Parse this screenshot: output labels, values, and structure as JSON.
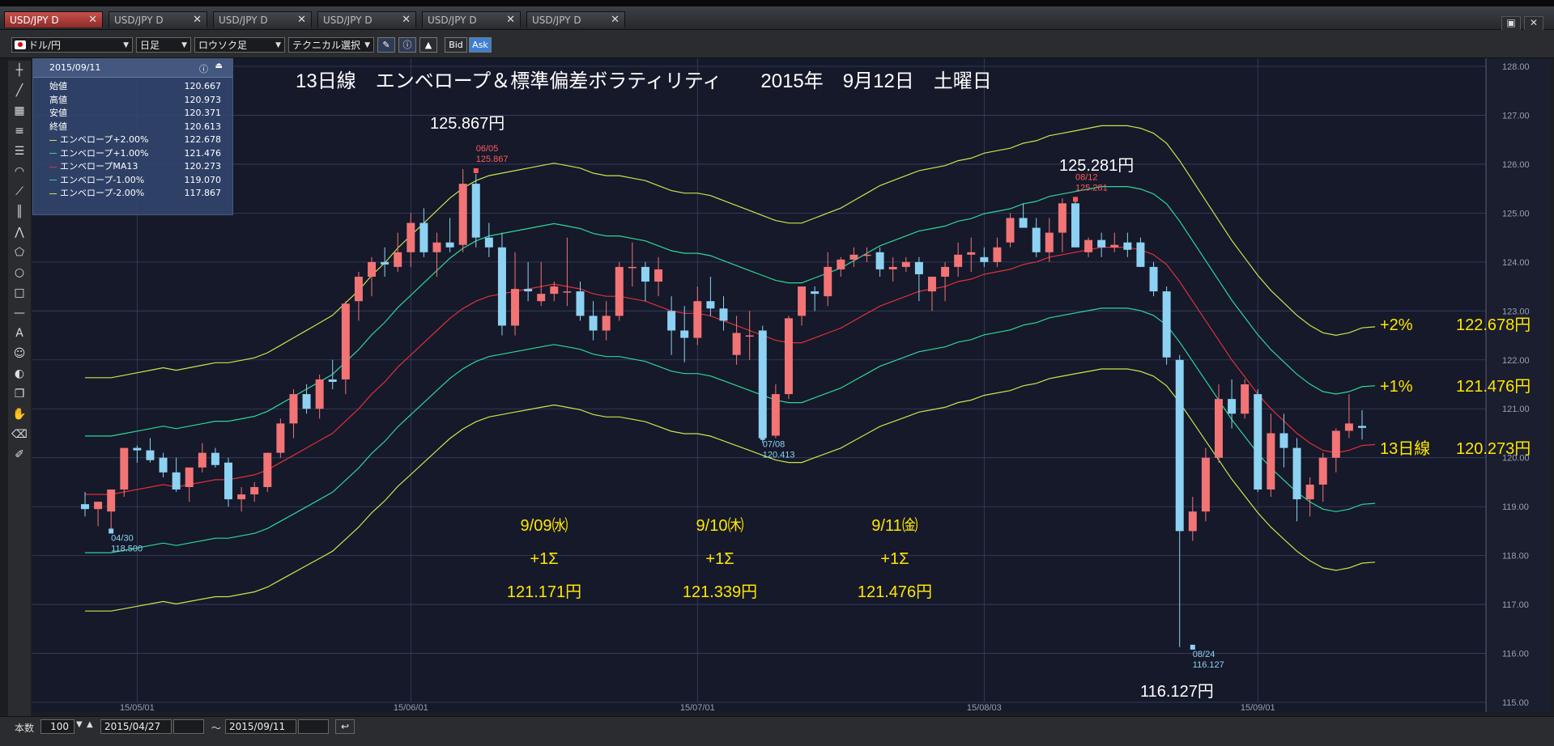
{
  "tabs": [
    {
      "label": "USD/JPY D",
      "active": true
    },
    {
      "label": "USD/JPY D",
      "active": false
    },
    {
      "label": "USD/JPY D",
      "active": false
    },
    {
      "label": "USD/JPY D",
      "active": false
    },
    {
      "label": "USD/JPY D",
      "active": false
    },
    {
      "label": "USD/JPY D",
      "active": false
    }
  ],
  "tab_close": "✕",
  "toolbar": {
    "pair": "ドル/円",
    "timeframe": "日足",
    "chart_type": "ロウソク足",
    "technical": "テクニカル選択",
    "bid": "Bid",
    "ask": "Ask"
  },
  "info_panel": {
    "date": "2015/09/11",
    "rows": [
      {
        "label": "始値",
        "value": "120.667",
        "color": ""
      },
      {
        "label": "高値",
        "value": "120.973",
        "color": ""
      },
      {
        "label": "安値",
        "value": "120.371",
        "color": ""
      },
      {
        "label": "終値",
        "value": "120.613",
        "color": ""
      },
      {
        "label": "エンベロープ+2.00%",
        "value": "122.678",
        "color": "#c8e64a"
      },
      {
        "label": "エンベロープ+1.00%",
        "value": "121.476",
        "color": "#2fd69a"
      },
      {
        "label": "エンベロープMA13",
        "value": "120.273",
        "color": "#e0303a"
      },
      {
        "label": "エンベロープ-1.00%",
        "value": "119.070",
        "color": "#2fd69a"
      },
      {
        "label": "エンベロープ-2.00%",
        "value": "117.867",
        "color": "#c8e64a"
      }
    ]
  },
  "bottom": {
    "count_label": "本数",
    "count_value": "100",
    "from_date": "2015/04/27",
    "tilde": "〜",
    "to_date": "2015/09/11"
  },
  "colors": {
    "background": "#15192a",
    "grid": "#3a4160",
    "up": "#f27475",
    "down": "#8dd2f2",
    "ma": "#e0303a",
    "env1": "#2fd69a",
    "env2": "#c8e64a",
    "annotation": "#ffe600"
  },
  "chart_data": {
    "type": "candlestick",
    "title": "13日線　エンベロープ＆標準偏差ボラティリティ　　2015年　9月12日　土曜日",
    "y_ticks": [
      "128.00",
      "127.00",
      "126.00",
      "125.00",
      "124.00",
      "123.00",
      "122.00",
      "121.00",
      "120.00",
      "119.00",
      "118.00",
      "117.00",
      "116.00",
      "115.00"
    ],
    "ylim": [
      115,
      128
    ],
    "x_ticks": [
      {
        "label": "15/05/01",
        "day": 4
      },
      {
        "label": "15/06/01",
        "day": 25
      },
      {
        "label": "15/07/01",
        "day": 47
      },
      {
        "label": "15/08/03",
        "day": 69
      },
      {
        "label": "15/09/01",
        "day": 90
      }
    ],
    "ohlc": [
      [
        119.05,
        119.3,
        118.8,
        118.95
      ],
      [
        118.95,
        119.1,
        118.6,
        119.1
      ],
      [
        118.9,
        119.3,
        118.5,
        119.35
      ],
      [
        119.35,
        120.2,
        119.2,
        120.2
      ],
      [
        120.2,
        120.25,
        119.9,
        120.15
      ],
      [
        120.15,
        120.4,
        119.9,
        119.95
      ],
      [
        120.0,
        120.1,
        119.6,
        119.7
      ],
      [
        119.7,
        120.0,
        119.3,
        119.35
      ],
      [
        119.4,
        119.8,
        119.1,
        119.8
      ],
      [
        119.8,
        120.3,
        119.7,
        120.1
      ],
      [
        120.1,
        120.2,
        119.8,
        119.85
      ],
      [
        119.9,
        120.0,
        119.0,
        119.15
      ],
      [
        119.15,
        119.4,
        118.9,
        119.25
      ],
      [
        119.25,
        119.5,
        119.1,
        119.4
      ],
      [
        119.4,
        120.1,
        119.3,
        120.1
      ],
      [
        120.1,
        120.8,
        120.0,
        120.7
      ],
      [
        120.7,
        121.4,
        120.4,
        121.3
      ],
      [
        121.3,
        121.5,
        120.9,
        121.0
      ],
      [
        121.0,
        121.7,
        120.8,
        121.6
      ],
      [
        121.6,
        122.0,
        121.4,
        121.55
      ],
      [
        121.6,
        123.2,
        121.3,
        123.15
      ],
      [
        123.2,
        123.8,
        122.8,
        123.7
      ],
      [
        123.7,
        124.1,
        123.3,
        124.0
      ],
      [
        124.0,
        124.3,
        123.7,
        123.95
      ],
      [
        123.9,
        124.6,
        123.8,
        124.2
      ],
      [
        124.2,
        125.0,
        123.9,
        124.8
      ],
      [
        124.8,
        125.1,
        124.1,
        124.2
      ],
      [
        124.2,
        124.6,
        123.7,
        124.4
      ],
      [
        124.4,
        124.9,
        124.2,
        124.3
      ],
      [
        124.35,
        125.9,
        124.2,
        125.6
      ],
      [
        125.6,
        125.8,
        124.3,
        124.5
      ],
      [
        124.5,
        124.8,
        124.1,
        124.3
      ],
      [
        124.3,
        124.6,
        122.5,
        122.7
      ],
      [
        122.7,
        124.2,
        122.5,
        123.45
      ],
      [
        123.45,
        124.0,
        123.2,
        123.4
      ],
      [
        123.2,
        124.0,
        123.1,
        123.35
      ],
      [
        123.35,
        123.6,
        123.2,
        123.5
      ],
      [
        123.4,
        124.5,
        123.1,
        123.4
      ],
      [
        123.4,
        123.6,
        122.8,
        122.9
      ],
      [
        122.9,
        123.2,
        122.4,
        122.6
      ],
      [
        122.6,
        123.2,
        122.4,
        122.9
      ],
      [
        122.9,
        124.0,
        122.8,
        123.9
      ],
      [
        123.9,
        124.4,
        123.5,
        123.9
      ],
      [
        123.9,
        124.0,
        123.2,
        123.6
      ],
      [
        123.6,
        124.1,
        123.3,
        123.85
      ],
      [
        123.0,
        123.3,
        122.1,
        122.6
      ],
      [
        122.6,
        123.1,
        121.95,
        122.45
      ],
      [
        122.45,
        123.5,
        122.3,
        123.2
      ],
      [
        123.2,
        123.7,
        122.9,
        123.05
      ],
      [
        123.05,
        123.3,
        122.6,
        122.8
      ],
      [
        122.1,
        122.9,
        121.9,
        122.55
      ],
      [
        122.5,
        123.0,
        122.0,
        122.5
      ],
      [
        122.6,
        122.7,
        120.3,
        120.4
      ],
      [
        120.45,
        121.5,
        120.4,
        121.3
      ],
      [
        121.3,
        122.9,
        121.2,
        122.85
      ],
      [
        122.9,
        123.5,
        122.7,
        123.5
      ],
      [
        123.4,
        123.5,
        123.0,
        123.35
      ],
      [
        123.3,
        124.2,
        123.1,
        123.9
      ],
      [
        123.85,
        124.1,
        123.7,
        124.05
      ],
      [
        124.05,
        124.3,
        123.9,
        124.15
      ],
      [
        124.15,
        124.3,
        124.0,
        124.15
      ],
      [
        124.2,
        124.3,
        123.7,
        123.85
      ],
      [
        123.85,
        124.1,
        123.6,
        123.9
      ],
      [
        123.9,
        124.1,
        123.8,
        124.0
      ],
      [
        124.0,
        124.1,
        123.2,
        123.75
      ],
      [
        123.4,
        123.6,
        123.0,
        123.7
      ],
      [
        123.7,
        124.0,
        123.2,
        123.9
      ],
      [
        123.9,
        124.4,
        123.7,
        124.15
      ],
      [
        124.15,
        124.5,
        123.8,
        124.2
      ],
      [
        124.1,
        124.3,
        123.9,
        124.0
      ],
      [
        124.0,
        124.5,
        123.9,
        124.3
      ],
      [
        124.4,
        125.0,
        124.3,
        124.9
      ],
      [
        124.9,
        125.2,
        124.7,
        124.7
      ],
      [
        124.7,
        124.9,
        124.1,
        124.2
      ],
      [
        124.2,
        124.9,
        124.0,
        124.6
      ],
      [
        124.6,
        125.3,
        124.2,
        125.2
      ],
      [
        125.2,
        125.3,
        124.3,
        124.3
      ],
      [
        124.2,
        124.5,
        124.1,
        124.45
      ],
      [
        124.45,
        124.6,
        124.1,
        124.3
      ],
      [
        124.3,
        124.6,
        124.2,
        124.35
      ],
      [
        124.4,
        124.6,
        124.1,
        124.25
      ],
      [
        124.4,
        124.5,
        123.9,
        123.9
      ],
      [
        123.9,
        124.0,
        123.3,
        123.4
      ],
      [
        123.4,
        123.5,
        121.9,
        122.05
      ],
      [
        122.0,
        122.1,
        116.13,
        118.5
      ],
      [
        118.5,
        119.2,
        118.3,
        118.9
      ],
      [
        118.9,
        120.2,
        118.7,
        120.0
      ],
      [
        120.0,
        121.5,
        119.9,
        121.2
      ],
      [
        121.2,
        121.6,
        120.6,
        120.9
      ],
      [
        120.9,
        121.6,
        120.8,
        121.5
      ],
      [
        121.3,
        121.4,
        119.3,
        119.35
      ],
      [
        119.35,
        120.9,
        119.2,
        120.5
      ],
      [
        120.5,
        120.9,
        119.8,
        120.2
      ],
      [
        120.2,
        120.4,
        118.7,
        119.15
      ],
      [
        119.15,
        119.6,
        118.8,
        119.45
      ],
      [
        119.45,
        120.1,
        119.1,
        120.0
      ],
      [
        120.0,
        120.6,
        119.7,
        120.55
      ],
      [
        120.55,
        121.3,
        120.4,
        120.7
      ],
      [
        120.65,
        120.97,
        120.37,
        120.61
      ]
    ],
    "ma13": [
      119.25,
      119.25,
      119.25,
      119.3,
      119.35,
      119.4,
      119.45,
      119.4,
      119.45,
      119.5,
      119.55,
      119.55,
      119.6,
      119.65,
      119.75,
      119.9,
      120.05,
      120.2,
      120.35,
      120.5,
      120.75,
      121.0,
      121.3,
      121.55,
      121.85,
      122.1,
      122.35,
      122.6,
      122.85,
      123.05,
      123.2,
      123.3,
      123.35,
      123.4,
      123.45,
      123.5,
      123.55,
      123.5,
      123.45,
      123.35,
      123.3,
      123.3,
      123.25,
      123.2,
      123.1,
      123.0,
      122.95,
      122.95,
      122.9,
      122.8,
      122.7,
      122.6,
      122.5,
      122.4,
      122.35,
      122.35,
      122.45,
      122.55,
      122.65,
      122.8,
      122.95,
      123.1,
      123.2,
      123.3,
      123.4,
      123.45,
      123.5,
      123.6,
      123.65,
      123.75,
      123.8,
      123.85,
      123.95,
      124.0,
      124.1,
      124.15,
      124.2,
      124.25,
      124.3,
      124.3,
      124.3,
      124.25,
      124.15,
      123.95,
      123.6,
      123.2,
      122.8,
      122.4,
      122.0,
      121.65,
      121.3,
      121.0,
      120.75,
      120.5,
      120.3,
      120.15,
      120.1,
      120.15,
      120.25,
      120.27
    ],
    "envelope_pct": [
      2,
      1,
      -1,
      -2
    ],
    "envelope_labels": [
      "エンベロープ+2.00%",
      "エンベロープ+1.00%",
      "エンベロープ-1.00%",
      "エンベロープ-2.00%"
    ],
    "markers": [
      {
        "day": 30,
        "date": "06/05",
        "value": "125.867",
        "kind": "high",
        "color": "#ff5a5a"
      },
      {
        "day": 76,
        "date": "08/12",
        "value": "125.281",
        "kind": "high",
        "color": "#ff5a5a"
      },
      {
        "day": 52,
        "date": "07/08",
        "value": "120.413",
        "kind": "low",
        "color": "#8dd2f2"
      },
      {
        "day": 2,
        "date": "04/30",
        "value": "118.500",
        "kind": "low",
        "color": "#8dd2f2"
      },
      {
        "day": 85,
        "date": "08/24",
        "value": "116.127",
        "kind": "low",
        "color": "#8dd2f2"
      }
    ],
    "annotations": {
      "high1": "125.867円",
      "high2": "125.281円",
      "low1": "116.127円",
      "right": [
        {
          "label": "+2%",
          "value": "122.678円"
        },
        {
          "label": "+1%",
          "value": "121.476円"
        },
        {
          "label": "13日線",
          "value": "120.273円"
        }
      ],
      "dates": [
        {
          "date": "9/09㈬",
          "sigma": "+1Σ",
          "value": "121.171円"
        },
        {
          "date": "9/10㈭",
          "sigma": "+1Σ",
          "value": "121.339円"
        },
        {
          "date": "9/11㈮",
          "sigma": "+1Σ",
          "value": "121.476円"
        }
      ]
    }
  }
}
